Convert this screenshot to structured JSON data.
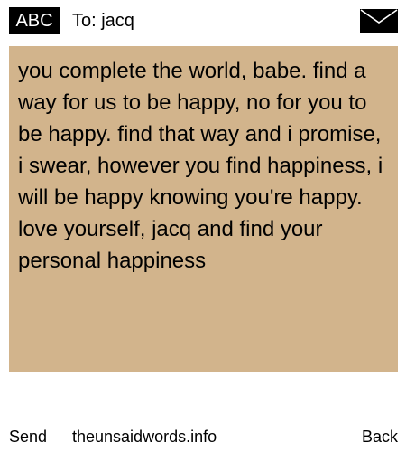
{
  "header": {
    "mode_badge": "ABC",
    "to_label": "To: jacq",
    "icon": "envelope-icon"
  },
  "message": {
    "body": "you complete the world, babe. find a way for us to be happy, no for you to be happy. find that way and i promise, i swear, however you find happiness, i will be happy knowing you're happy. love yourself, jacq and find your personal happiness",
    "background_color": "#d2b48c"
  },
  "footer": {
    "send_label": "Send",
    "site_label": "theunsaidwords.info",
    "back_label": "Back"
  }
}
